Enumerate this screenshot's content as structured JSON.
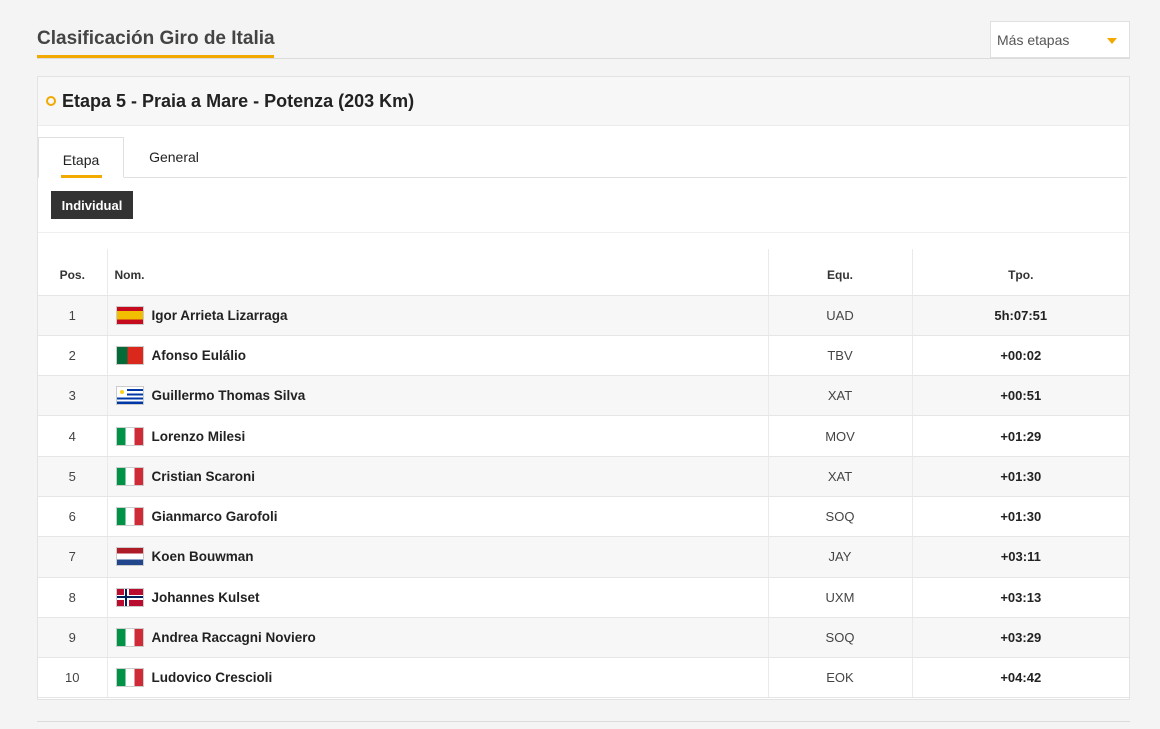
{
  "header": {
    "title": "Clasificación Giro de Italia",
    "stage_select": "Más etapas",
    "accent": "#f2a900"
  },
  "stage": {
    "title": "Etapa 5 - Praia a Mare - Potenza (203 Km)"
  },
  "tabs": [
    {
      "label": "Etapa",
      "active": true
    },
    {
      "label": "General",
      "active": false
    }
  ],
  "filter_button": "Individual",
  "table": {
    "headers": {
      "pos": "Pos.",
      "name": "Nom.",
      "team": "Equ.",
      "time": "Tpo."
    },
    "rows": [
      {
        "pos": "1",
        "flag": "es",
        "name": "Igor Arrieta Lizarraga",
        "team": "UAD",
        "time": "5h:07:51"
      },
      {
        "pos": "2",
        "flag": "pt",
        "name": "Afonso Eulálio",
        "team": "TBV",
        "time": "+00:02"
      },
      {
        "pos": "3",
        "flag": "uy",
        "name": "Guillermo Thomas Silva",
        "team": "XAT",
        "time": "+00:51"
      },
      {
        "pos": "4",
        "flag": "it",
        "name": "Lorenzo Milesi",
        "team": "MOV",
        "time": "+01:29"
      },
      {
        "pos": "5",
        "flag": "it",
        "name": "Cristian Scaroni",
        "team": "XAT",
        "time": "+01:30"
      },
      {
        "pos": "6",
        "flag": "it",
        "name": "Gianmarco Garofoli",
        "team": "SOQ",
        "time": "+01:30"
      },
      {
        "pos": "7",
        "flag": "nl",
        "name": "Koen Bouwman",
        "team": "JAY",
        "time": "+03:11"
      },
      {
        "pos": "8",
        "flag": "no",
        "name": "Johannes Kulset",
        "team": "UXM",
        "time": "+03:13"
      },
      {
        "pos": "9",
        "flag": "it",
        "name": "Andrea Raccagni Noviero",
        "team": "SOQ",
        "time": "+03:29"
      },
      {
        "pos": "10",
        "flag": "it",
        "name": "Ludovico Crescioli",
        "team": "EOK",
        "time": "+04:42"
      }
    ]
  }
}
